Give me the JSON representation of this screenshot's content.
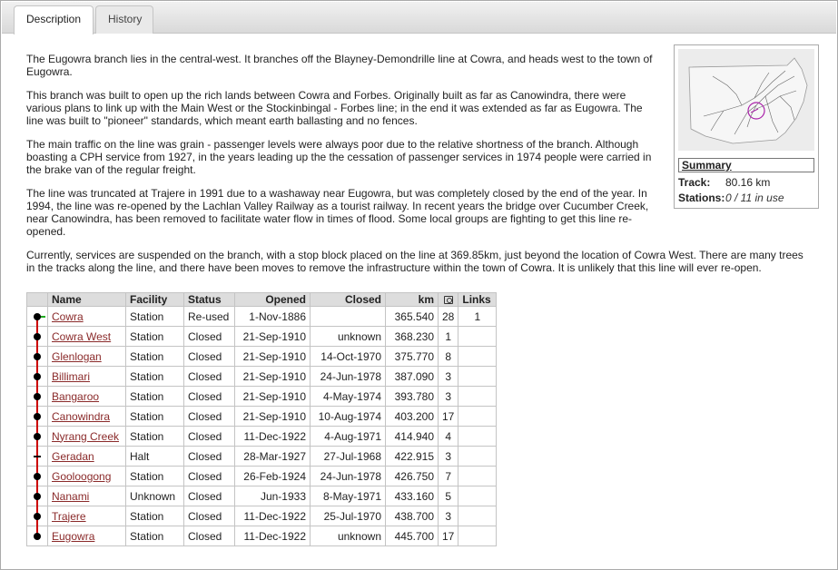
{
  "tabs": [
    {
      "label": "Description",
      "active": true
    },
    {
      "label": "History",
      "active": false
    }
  ],
  "description": {
    "paragraphs": [
      "The Eugowra branch lies in the central-west. It branches off the Blayney-Demondrille line at Cowra, and heads west to the town of Eugowra.",
      "This branch was built to open up the rich lands between Cowra and Forbes. Originally built as far as Canowindra, there were various plans to link up with the Main West or the Stockinbingal - Forbes line; in the end it was extended as far as Eugowra. The line was built to \"pioneer\" standards, which meant earth ballasting and no fences.",
      "The main traffic on the line was grain - passenger levels were always poor due to the relative shortness of the branch. Although boasting a CPH service from 1927, in the years leading up the the cessation of passenger services in 1974 people were carried in the brake van of the regular freight.",
      "The line was truncated at Trajere in 1991 due to a washaway near Eugowra, but was completely closed by the end of the year. In 1994, the line was re-opened by the Lachlan Valley Railway as a tourist railway. In recent years the bridge over Cucumber Creek, near Canowindra, has been removed to facilitate water flow in times of flood. Some local groups are fighting to get this line re-opened.",
      "Currently, services are suspended on the branch, with a stop block placed on the line at 369.85km, just beyond the location of Cowra West. There are many trees in the tracks along the line, and there have been moves to remove the infrastructure within the town of Cowra. It is unlikely that this line will ever re-open."
    ]
  },
  "summary": {
    "title": "Summary",
    "track_label": "Track:",
    "track_value": "80.16 km",
    "stations_label": "Stations:",
    "stations_value": "0 / 11 in use"
  },
  "table": {
    "headers": {
      "name": "Name",
      "facility": "Facility",
      "status": "Status",
      "opened": "Opened",
      "closed": "Closed",
      "km": "km",
      "links": "Links"
    },
    "rows": [
      {
        "name": "Cowra",
        "facility": "Station",
        "status": "Re-used",
        "opened": "1-Nov-1886",
        "closed": "",
        "km": "365.540",
        "photos": "28",
        "links": "1"
      },
      {
        "name": "Cowra West",
        "facility": "Station",
        "status": "Closed",
        "opened": "21-Sep-1910",
        "closed": "unknown",
        "km": "368.230",
        "photos": "1",
        "links": ""
      },
      {
        "name": "Glenlogan",
        "facility": "Station",
        "status": "Closed",
        "opened": "21-Sep-1910",
        "closed": "14-Oct-1970",
        "km": "375.770",
        "photos": "8",
        "links": ""
      },
      {
        "name": "Billimari",
        "facility": "Station",
        "status": "Closed",
        "opened": "21-Sep-1910",
        "closed": "24-Jun-1978",
        "km": "387.090",
        "photos": "3",
        "links": ""
      },
      {
        "name": "Bangaroo",
        "facility": "Station",
        "status": "Closed",
        "opened": "21-Sep-1910",
        "closed": "4-May-1974",
        "km": "393.780",
        "photos": "3",
        "links": ""
      },
      {
        "name": "Canowindra",
        "facility": "Station",
        "status": "Closed",
        "opened": "21-Sep-1910",
        "closed": "10-Aug-1974",
        "km": "403.200",
        "photos": "17",
        "links": ""
      },
      {
        "name": "Nyrang Creek",
        "facility": "Station",
        "status": "Closed",
        "opened": "11-Dec-1922",
        "closed": "4-Aug-1971",
        "km": "414.940",
        "photos": "4",
        "links": ""
      },
      {
        "name": "Geradan",
        "facility": "Halt",
        "status": "Closed",
        "opened": "28-Mar-1927",
        "closed": "27-Jul-1968",
        "km": "422.915",
        "photos": "3",
        "links": ""
      },
      {
        "name": "Gooloogong",
        "facility": "Station",
        "status": "Closed",
        "opened": "26-Feb-1924",
        "closed": "24-Jun-1978",
        "km": "426.750",
        "photos": "7",
        "links": ""
      },
      {
        "name": "Nanami",
        "facility": "Unknown",
        "status": "Closed",
        "opened": "Jun-1933",
        "closed": "8-May-1971",
        "km": "433.160",
        "photos": "5",
        "links": ""
      },
      {
        "name": "Trajere",
        "facility": "Station",
        "status": "Closed",
        "opened": "11-Dec-1922",
        "closed": "25-Jul-1970",
        "km": "438.700",
        "photos": "3",
        "links": ""
      },
      {
        "name": "Eugowra",
        "facility": "Station",
        "status": "Closed",
        "opened": "11-Dec-1922",
        "closed": "unknown",
        "km": "445.700",
        "photos": "17",
        "links": ""
      }
    ]
  },
  "icons": {
    "photos_header": "camera-icon",
    "map": "nsw-map-icon"
  },
  "colors": {
    "link": "#8a2a2a",
    "track_line": "#cc0000",
    "junction": "#22aa22",
    "map_highlight": "#aa22aa"
  }
}
